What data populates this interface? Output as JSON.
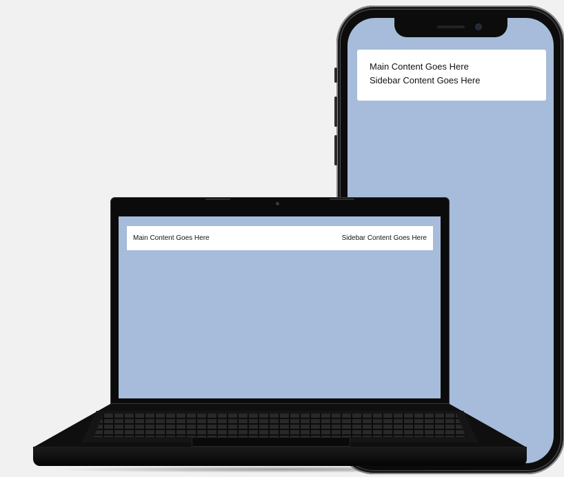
{
  "colors": {
    "page_background": "#f1f1f1",
    "screen_background": "#a6bcda",
    "card_background": "#ffffff",
    "device_body": "#0c0c0c",
    "text": "#111111"
  },
  "phone": {
    "card": {
      "main_text": "Main Content Goes Here",
      "sidebar_text": "Sidebar Content Goes Here"
    }
  },
  "laptop": {
    "card": {
      "main_text": "Main Content Goes Here",
      "sidebar_text": "Sidebar Content Goes Here"
    }
  }
}
